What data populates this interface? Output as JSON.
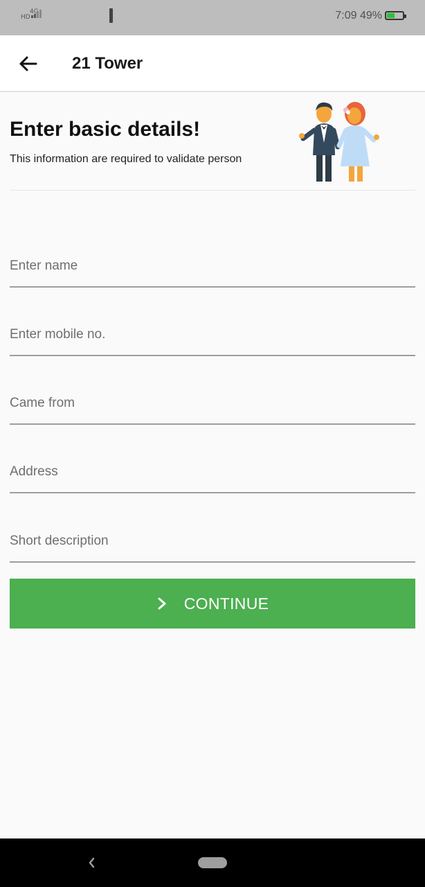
{
  "status_bar": {
    "hd_label": "HD",
    "network_label": "4G",
    "time": "7:09",
    "battery_percent": "49%",
    "battery_level": 0.49
  },
  "app_bar": {
    "title": "21 Tower",
    "back_icon": "arrow-left-icon"
  },
  "intro": {
    "heading": "Enter basic details!",
    "subheading": "This information are required to validate person",
    "illustration": "couple-illustration"
  },
  "form": {
    "fields": [
      {
        "placeholder": "Enter name",
        "value": ""
      },
      {
        "placeholder": "Enter mobile no.",
        "value": ""
      },
      {
        "placeholder": "Came from",
        "value": ""
      },
      {
        "placeholder": "Address",
        "value": ""
      },
      {
        "placeholder": "Short description",
        "value": ""
      }
    ],
    "continue_label": "CONTINUE",
    "continue_icon": "chevron-right-icon",
    "accent_color": "#4caf50"
  },
  "nav_bar": {
    "back_icon": "nav-back-icon",
    "home_icon": "home-pill-icon"
  }
}
